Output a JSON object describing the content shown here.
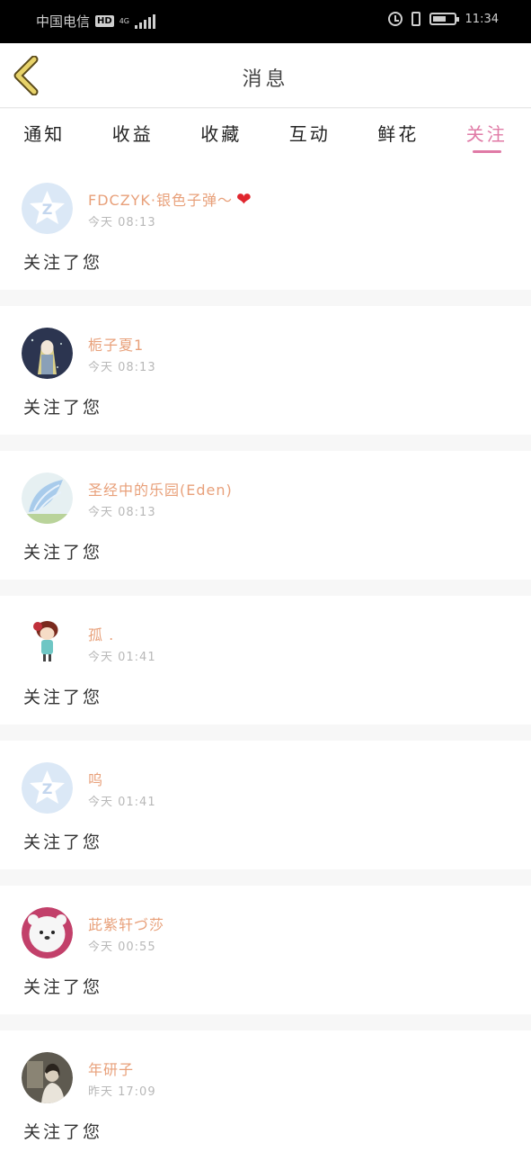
{
  "status_bar": {
    "carrier": "中国电信",
    "hd": "HD",
    "network": "4G",
    "time": "11:34"
  },
  "header": {
    "title": "消息",
    "back_icon": "chevron-left-icon"
  },
  "tabs": [
    {
      "label": "通知",
      "active": false
    },
    {
      "label": "收益",
      "active": false
    },
    {
      "label": "收藏",
      "active": false
    },
    {
      "label": "互动",
      "active": false
    },
    {
      "label": "鲜花",
      "active": false
    },
    {
      "label": "关注",
      "active": true
    }
  ],
  "accent_color": "#e07aa6",
  "name_color": "#e8a07a",
  "messages": [
    {
      "name": "FDCZYK·银色子弹～",
      "has_heart": true,
      "time": "今天 08:13",
      "text": "关注了您",
      "avatar": "default-qzone-avatar"
    },
    {
      "name": "栀子夏1",
      "has_heart": false,
      "time": "今天 08:13",
      "text": "关注了您",
      "avatar": "anime-girl-avatar"
    },
    {
      "name": "圣经中的乐园(Eden)",
      "has_heart": false,
      "time": "今天 08:13",
      "text": "关注了您",
      "avatar": "blue-wing-avatar"
    },
    {
      "name": "孤 .",
      "has_heart": false,
      "time": "今天 01:41",
      "text": "关注了您",
      "avatar": "cartoon-girl-avatar"
    },
    {
      "name": "呜",
      "has_heart": false,
      "time": "今天 01:41",
      "text": "关注了您",
      "avatar": "default-qzone-avatar"
    },
    {
      "name": "茈紫轩づ莎",
      "has_heart": false,
      "time": "今天 00:55",
      "text": "关注了您",
      "avatar": "white-plush-avatar"
    },
    {
      "name": "年研子",
      "has_heart": false,
      "time": "昨天 17:09",
      "text": "关注了您",
      "avatar": "photo-avatar"
    }
  ]
}
